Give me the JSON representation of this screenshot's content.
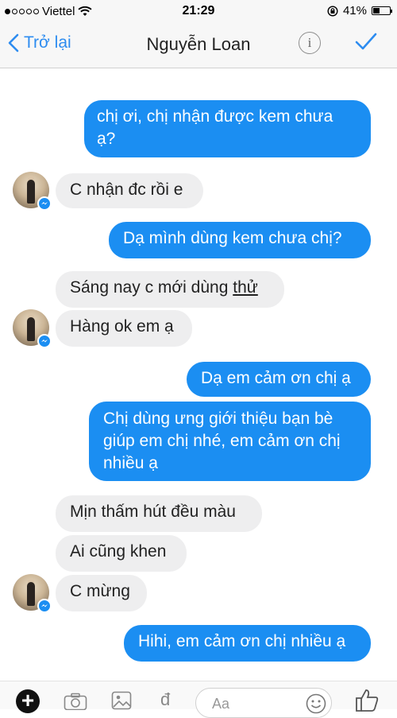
{
  "status_bar": {
    "carrier": "Viettel",
    "time": "21:29",
    "battery": "41%",
    "battery_level": 0.41,
    "signal_bars_filled": 1
  },
  "nav": {
    "back_label": "Trở lại",
    "title": "Nguyễn Loan",
    "icons": {
      "back": "chevron-left-icon",
      "info": "info-icon",
      "done": "checkmark-icon"
    },
    "info_glyph": "i"
  },
  "messages": [
    {
      "direction": "outgoing",
      "lines": [
        "chị ơi, chị nhận được kem chưa",
        "ạ?"
      ]
    },
    {
      "direction": "incoming",
      "text": "C nhận đc rồi e"
    },
    {
      "direction": "outgoing",
      "text": "Dạ mình dùng kem chưa chị?"
    },
    {
      "direction": "incoming",
      "text_before": "Sáng nay c mới dùng ",
      "text_underlined": "thử"
    },
    {
      "direction": "incoming",
      "text": "Hàng ok em ạ"
    },
    {
      "direction": "outgoing",
      "text": "Dạ em cảm ơn chị ạ"
    },
    {
      "direction": "outgoing",
      "lines": [
        "Chị dùng ưng giới thiệu bạn bè",
        "giúp em chị nhé, em cảm ơn chị",
        "nhiều ạ"
      ]
    },
    {
      "direction": "incoming",
      "text": "Mịn thấm hút đều màu"
    },
    {
      "direction": "incoming",
      "text": "Ai cũng khen"
    },
    {
      "direction": "incoming",
      "text": "C mừng"
    },
    {
      "direction": "outgoing",
      "text": "Hihi, em cảm ơn chị nhiều ạ"
    }
  ],
  "toolbar": {
    "plus_glyph": "+",
    "compose_placeholder": "Aa",
    "icons": [
      "plus-icon",
      "camera-icon",
      "photo-icon",
      "payment-icon",
      "emoji-icon",
      "like-icon"
    ],
    "payment_glyph": "đ"
  },
  "colors": {
    "accent": "#2d8cf0",
    "outgoing_bubble": "#1b8ef2",
    "incoming_bubble": "#eeeeef"
  }
}
